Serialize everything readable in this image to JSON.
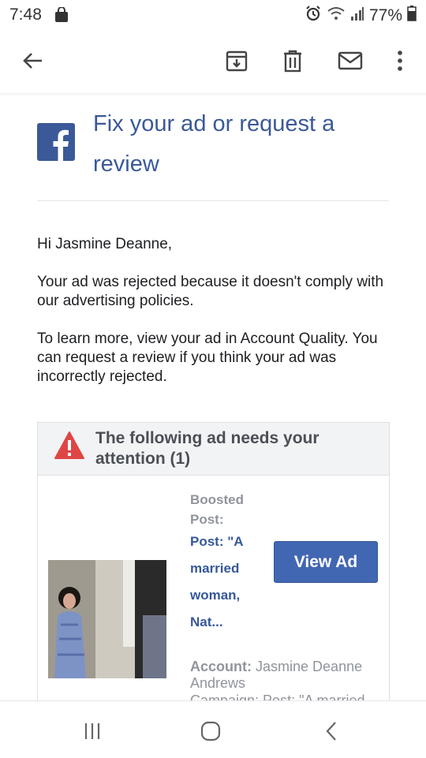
{
  "status_bar": {
    "time": "7:48",
    "battery": "77%",
    "icons": [
      "notification-bag-icon",
      "alarm-icon",
      "wifi-icon",
      "signal-icon",
      "battery-icon"
    ]
  },
  "toolbar": {
    "icons": [
      "back-arrow-icon",
      "archive-icon",
      "delete-icon",
      "mark-unread-icon",
      "more-options-icon"
    ]
  },
  "email": {
    "brand_icon": "facebook-logo",
    "headline": "Fix your ad or request a review",
    "greeting": "Hi Jasmine Deanne,",
    "paragraph1": "Your ad was rejected because it doesn't comply with our advertising policies.",
    "paragraph2": "To learn more, view your ad in Account Quality. You can request a review if you think your ad was incorrectly rejected."
  },
  "card": {
    "header": "The following ad needs your attention (1)",
    "warning_icon": "warning-triangle-icon",
    "ad": {
      "type_label": "Boosted Post:",
      "post_text": "Post: \"A married woman, Nat...",
      "view_button": "View Ad",
      "account_label": "Account:",
      "account_value": "Jasmine Deanne Andrews",
      "campaign_partial": "Campaign: Post: \"A married"
    }
  },
  "nav_bar": {
    "icons": [
      "recent-apps-icon",
      "home-icon",
      "back-icon"
    ]
  },
  "colors": {
    "facebook_blue": "#3b5998",
    "button_blue": "#4267b2",
    "warning_red": "#e04545",
    "muted_gray": "#90949c"
  }
}
